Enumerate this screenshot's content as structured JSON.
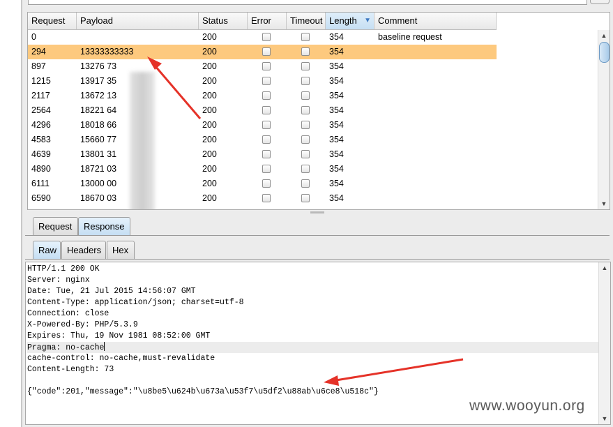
{
  "table": {
    "columns": [
      "Request",
      "Payload",
      "Status",
      "Error",
      "Timeout",
      "Length",
      "Comment"
    ],
    "sorted_column": "Length",
    "rows": [
      {
        "request": "0",
        "payload": "",
        "status": "200",
        "length": "354",
        "comment": "baseline request"
      },
      {
        "request": "294",
        "payload": "13333333333",
        "status": "200",
        "length": "354",
        "comment": ""
      },
      {
        "request": "897",
        "payload": "13276      73",
        "status": "200",
        "length": "354",
        "comment": ""
      },
      {
        "request": "1215",
        "payload": "13917      35",
        "status": "200",
        "length": "354",
        "comment": ""
      },
      {
        "request": "2117",
        "payload": "13672      13",
        "status": "200",
        "length": "354",
        "comment": ""
      },
      {
        "request": "2564",
        "payload": "18221      64",
        "status": "200",
        "length": "354",
        "comment": ""
      },
      {
        "request": "4296",
        "payload": "18018      66",
        "status": "200",
        "length": "354",
        "comment": ""
      },
      {
        "request": "4583",
        "payload": "15660      77",
        "status": "200",
        "length": "354",
        "comment": ""
      },
      {
        "request": "4639",
        "payload": "13801      31",
        "status": "200",
        "length": "354",
        "comment": ""
      },
      {
        "request": "4890",
        "payload": "18721      03",
        "status": "200",
        "length": "354",
        "comment": ""
      },
      {
        "request": "6111",
        "payload": "13000      00",
        "status": "200",
        "length": "354",
        "comment": ""
      },
      {
        "request": "6590",
        "payload": "18670      03",
        "status": "200",
        "length": "354",
        "comment": ""
      }
    ],
    "selected_row": 1
  },
  "tabs": {
    "outer": [
      "Request",
      "Response"
    ],
    "outer_active": "Response",
    "inner": [
      "Raw",
      "Headers",
      "Hex"
    ],
    "inner_active": "Raw"
  },
  "response_lines": [
    "HTTP/1.1 200 OK",
    "Server: nginx",
    "Date: Tue, 21 Jul 2015 14:56:07 GMT",
    "Content-Type: application/json; charset=utf-8",
    "Connection: close",
    "X-Powered-By: PHP/5.3.9",
    "Expires: Thu, 19 Nov 1981 08:52:00 GMT",
    "Pragma: no-cache",
    "cache-control: no-cache,must-revalidate",
    "Content-Length: 73",
    "",
    "{\"code\":201,\"message\":\"\\u8be5\\u624b\\u673a\\u53f7\\u5df2\\u88ab\\u6ce8\\u518c\"}"
  ],
  "watermark": "www.wooyun.org",
  "colors": {
    "selected_row": "#fdc97e",
    "annotation_arrow": "#e53228",
    "active_tab": "#c5def3"
  }
}
